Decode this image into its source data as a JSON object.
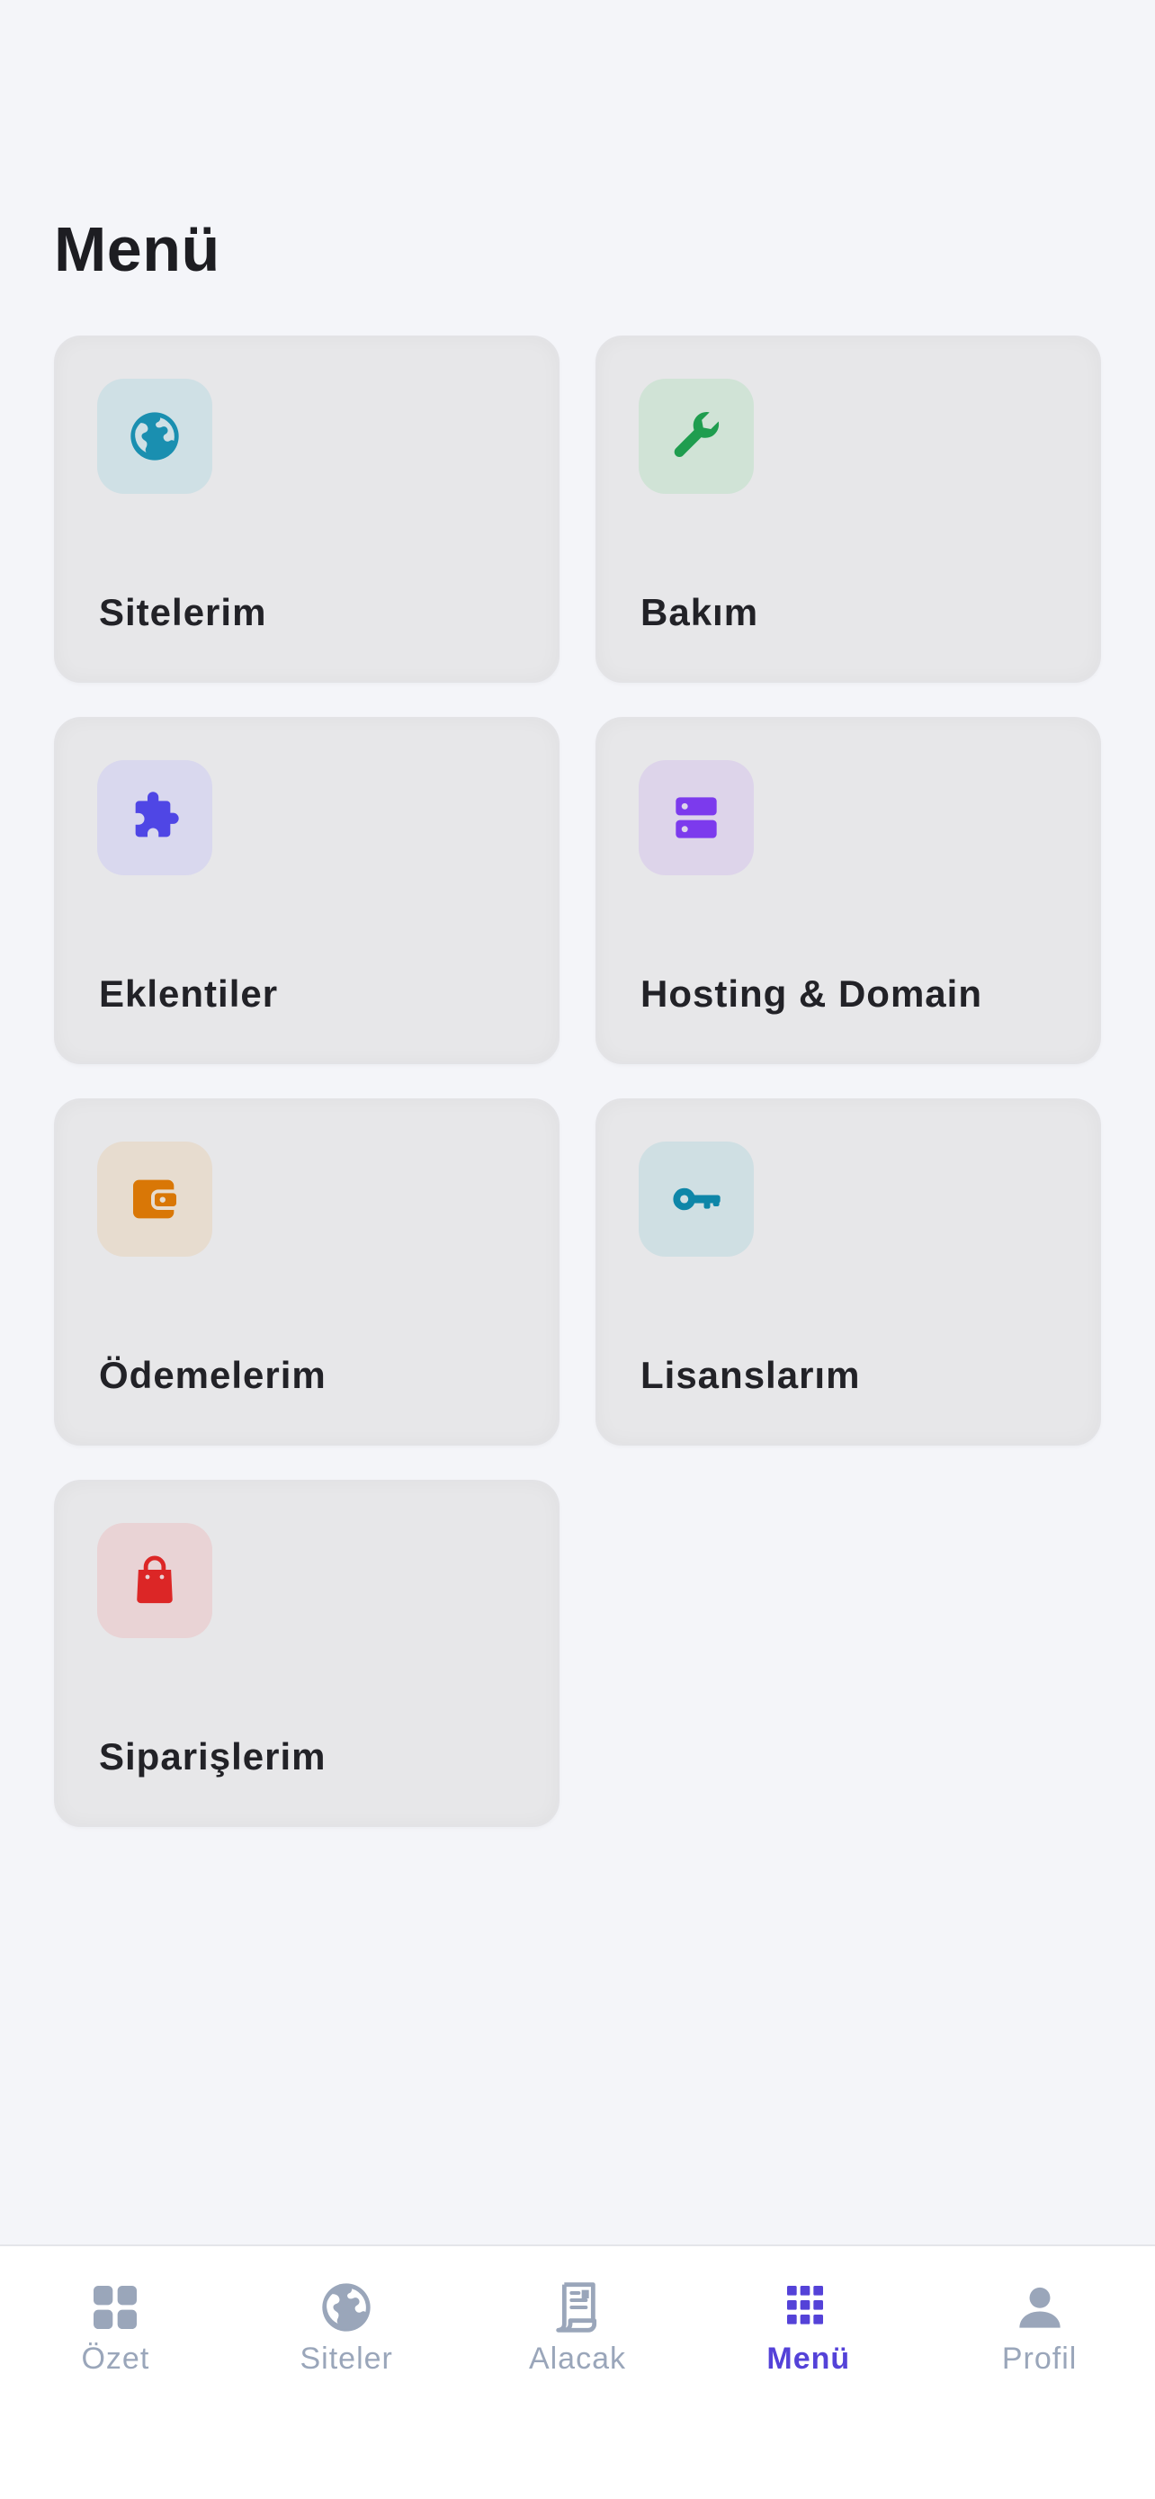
{
  "page": {
    "title": "Menü"
  },
  "menu": {
    "items": [
      {
        "label": "Sitelerim",
        "icon": "globe-icon",
        "color": "#1a8fb0",
        "tile": "#cfe0e5"
      },
      {
        "label": "Bakım",
        "icon": "wrench-icon",
        "color": "#1f9d4f",
        "tile": "#d0e3d6"
      },
      {
        "label": "Eklentiler",
        "icon": "puzzle-icon",
        "color": "#4f46e5",
        "tile": "#d9d8ee"
      },
      {
        "label": "Hosting & Domain",
        "icon": "server-icon",
        "color": "#7c3aed",
        "tile": "#ddd4ea"
      },
      {
        "label": "Ödemelerim",
        "icon": "wallet-icon",
        "color": "#d97706",
        "tile": "#e7dccf"
      },
      {
        "label": "Lisanslarım",
        "icon": "key-icon",
        "color": "#0e86a8",
        "tile": "#cfdfe3"
      },
      {
        "label": "Siparişlerim",
        "icon": "shopping-bag-icon",
        "color": "#dc2626",
        "tile": "#e9d3d5"
      }
    ]
  },
  "tabbar": {
    "active_color": "#5442d8",
    "inactive_color": "#9aa6ba",
    "tabs": [
      {
        "label": "Özet",
        "icon": "dashboard-grid-icon",
        "active": false
      },
      {
        "label": "Siteler",
        "icon": "globe-icon",
        "active": false
      },
      {
        "label": "Alacak",
        "icon": "receipt-icon",
        "active": false
      },
      {
        "label": "Menü",
        "icon": "apps-grid-icon",
        "active": true
      },
      {
        "label": "Profil",
        "icon": "person-icon",
        "active": false
      }
    ]
  }
}
